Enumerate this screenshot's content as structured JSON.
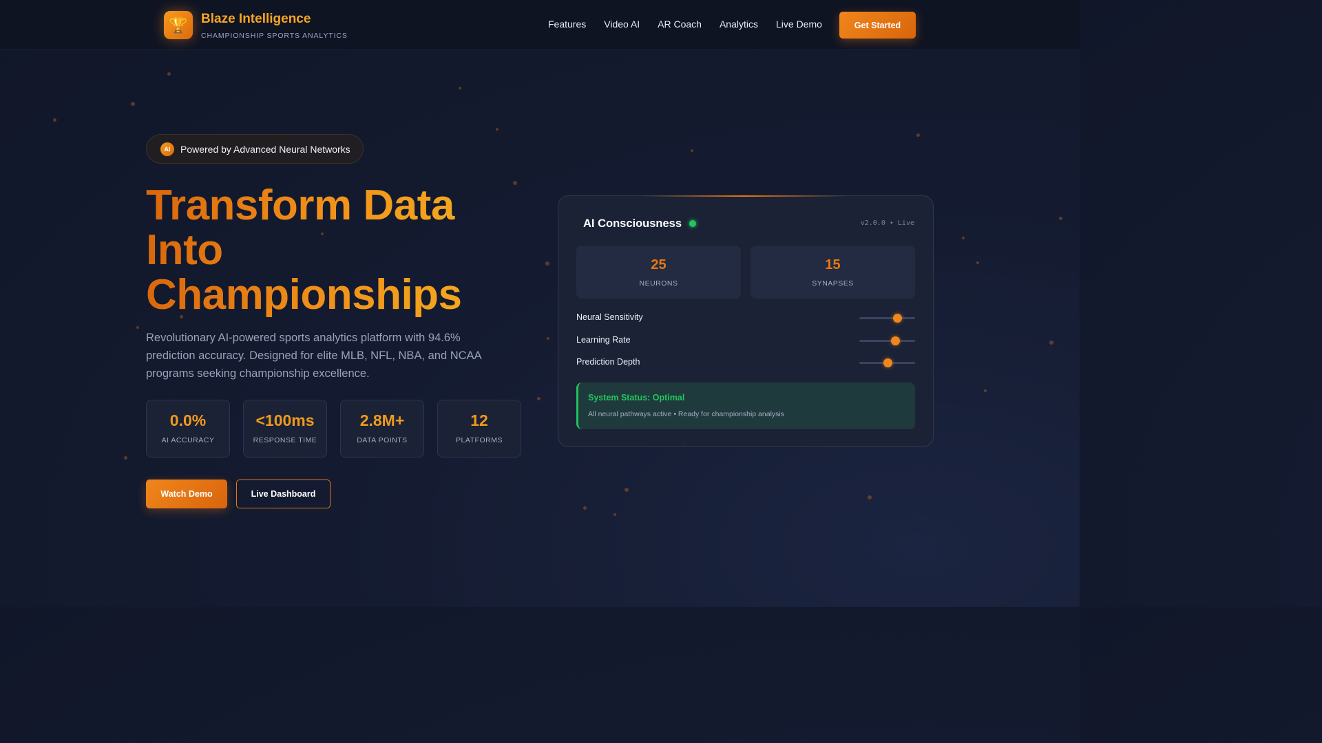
{
  "header": {
    "logo_icon": "trophy-icon",
    "brand_name": "Blaze Intelligence",
    "brand_tagline": "CHAMPIONSHIP SPORTS ANALYTICS",
    "nav": [
      "Features",
      "Video AI",
      "AR Coach",
      "Analytics",
      "Live Demo"
    ],
    "cta_label": "Get Started"
  },
  "hero": {
    "badge_icon_text": "AI",
    "badge_text": "Powered by Advanced Neural Networks",
    "title_lines": [
      "Transform Data",
      "Into",
      "Championships"
    ],
    "description": "Revolutionary AI-powered sports analytics platform with 94.6% prediction accuracy. Designed for elite MLB, NFL, NBA, and NCAA programs seeking championship excellence.",
    "stats": [
      {
        "value": "0.0%",
        "label": "AI ACCURACY"
      },
      {
        "value": "<100ms",
        "label": "RESPONSE TIME"
      },
      {
        "value": "2.8M+",
        "label": "DATA POINTS"
      },
      {
        "value": "12",
        "label": "PLATFORMS"
      }
    ],
    "primary_button": "Watch Demo",
    "secondary_button": "Live Dashboard"
  },
  "panel": {
    "title": "AI Consciousness",
    "version": "v2.0.0 • Live",
    "metrics": [
      {
        "value": "25",
        "label": "NEURONS"
      },
      {
        "value": "15",
        "label": "SYNAPSES"
      }
    ],
    "sliders": [
      {
        "label": "Neural Sensitivity",
        "level": 0.68
      },
      {
        "label": "Learning Rate",
        "level": 0.64
      },
      {
        "label": "Prediction Depth",
        "level": 0.5
      }
    ],
    "status_title": "System Status: Optimal",
    "status_desc": "All neural pathways active • Ready for championship analysis"
  },
  "colors": {
    "accent": "#f0861c",
    "accent_light": "#f5a623",
    "success": "#22c55e",
    "background": "#131a2d"
  }
}
